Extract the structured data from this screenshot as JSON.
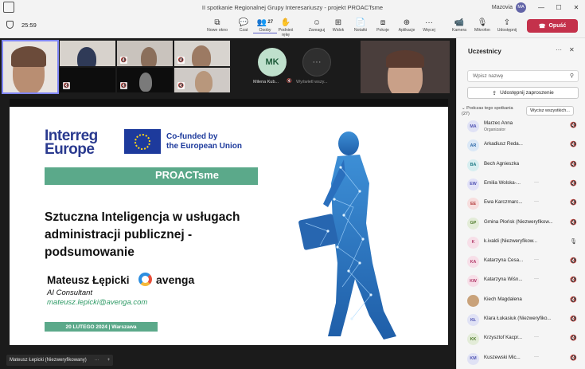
{
  "window": {
    "title": "II spotkanie Regionalnej Grupy Interesariuszy - projekt PROACTsme",
    "user": "Mazovia",
    "user_initials": "MA",
    "controls": {
      "minimize": "—",
      "maximize": "☐",
      "close": "✕"
    }
  },
  "toolbar": {
    "timer": "25:59",
    "tools": [
      {
        "label": "Nowe okno",
        "icon": "⧉"
      },
      {
        "label": "Czat",
        "icon": "💬"
      },
      {
        "label": "Osoby",
        "icon": "👥",
        "count": "27"
      },
      {
        "label": "Podnieś rękę",
        "icon": "✋"
      },
      {
        "label": "Zareaguj",
        "icon": "☺"
      },
      {
        "label": "Widok",
        "icon": "⊞"
      },
      {
        "label": "Notatki",
        "icon": "📄"
      },
      {
        "label": "Pokoje",
        "icon": "⧈"
      },
      {
        "label": "Aplikacje",
        "icon": "⊕"
      },
      {
        "label": "Więcej",
        "icon": "···"
      },
      {
        "label": "Kamera",
        "icon": "📹"
      },
      {
        "label": "Mikrofon",
        "icon": "🎙"
      },
      {
        "label": "Udostępnij",
        "icon": "⇪"
      }
    ],
    "leave_label": "Opuść"
  },
  "stage": {
    "tile_mk": {
      "initials": "MK",
      "name": "Milena Kub..."
    },
    "tile_more": {
      "initials": "···",
      "name": "Wyświetl wszy..."
    },
    "presenter_caption": "Mateusz Łepicki (Niezweryfikowany)",
    "caption_more": "···",
    "caption_add": "+"
  },
  "slide": {
    "logo_line1": "Interreg",
    "logo_line2": "Europe",
    "cofunded_line1": "Co-funded by",
    "cofunded_line2": "the European Union",
    "program": "PROACTsme",
    "title": "Sztuczna Inteligencja w usługach administracji publicznej - podsumowanie",
    "presenter": "Mateusz Łępicki",
    "company": "avenga",
    "role": "AI Consultant",
    "email": "mateusz.lepicki@avenga.com",
    "date": "20 LUTEGO 2024 | Warszawa"
  },
  "panel": {
    "title": "Uczestnicy",
    "search_placeholder": "Wpisz nazwę",
    "share_label": "Udostępnij zaproszenie",
    "section_label": "Podczas tego spotkania",
    "section_count": "(27)",
    "mute_all_label": "Wycisz wszystkich...",
    "participants": [
      {
        "initials": "MA",
        "name": "Marzec Anna",
        "sub": "Organizator",
        "bg": "#e0e2f5",
        "fg": "#4f52b2",
        "mic": "muted"
      },
      {
        "initials": "AR",
        "name": "Arkadiusz Reda...",
        "more": "",
        "bg": "#dbe8f6",
        "fg": "#2f6aa8",
        "mic": "muted"
      },
      {
        "initials": "BA",
        "name": "Bech Agnieszka",
        "bg": "#d7eef0",
        "fg": "#1e7a85",
        "mic": "muted"
      },
      {
        "initials": "EW",
        "name": "Emilia Wolska-...",
        "more": "···",
        "bg": "#e2e2f8",
        "fg": "#4f52b2",
        "mic": "muted"
      },
      {
        "initials": "EE",
        "name": "Ewa Karczmarc...",
        "more": "···",
        "bg": "#f7dede",
        "fg": "#b23b3b",
        "mic": "muted"
      },
      {
        "initials": "GP",
        "name": "Gmina Płońsk (Niezweryfikow...",
        "bg": "#e3ecd8",
        "fg": "#4f7a2b",
        "mic": "muted"
      },
      {
        "initials": "K",
        "name": "k.ivaldi (Niezweryfikow...",
        "bg": "#f7dfe8",
        "fg": "#b23b6a",
        "mic": "on"
      },
      {
        "initials": "KA",
        "name": "Katarzyna Cesa...",
        "more": "···",
        "bg": "#f7dfe8",
        "fg": "#b23b6a",
        "mic": "muted"
      },
      {
        "initials": "KW",
        "name": "Katarzyna Wiśn...",
        "more": "···",
        "bg": "#f7dfe8",
        "fg": "#b23b6a",
        "mic": "muted"
      },
      {
        "initials": "",
        "name": "Kiech Magdalena",
        "bg": "#c9a27a",
        "fg": "#ffffff",
        "mic": "muted",
        "photo": true
      },
      {
        "initials": "KŁ",
        "name": "Klara Łukasiuk (Niezweryfiko...",
        "bg": "#e0e2f5",
        "fg": "#4f52b2",
        "mic": "muted"
      },
      {
        "initials": "KK",
        "name": "Krzysztof Kacpr...",
        "more": "···",
        "bg": "#e3ecd8",
        "fg": "#4f7a2b",
        "mic": "muted"
      },
      {
        "initials": "KM",
        "name": "Kuszewski Mic...",
        "more": "···",
        "bg": "#e0e2f5",
        "fg": "#4f52b2",
        "mic": "muted"
      }
    ]
  }
}
